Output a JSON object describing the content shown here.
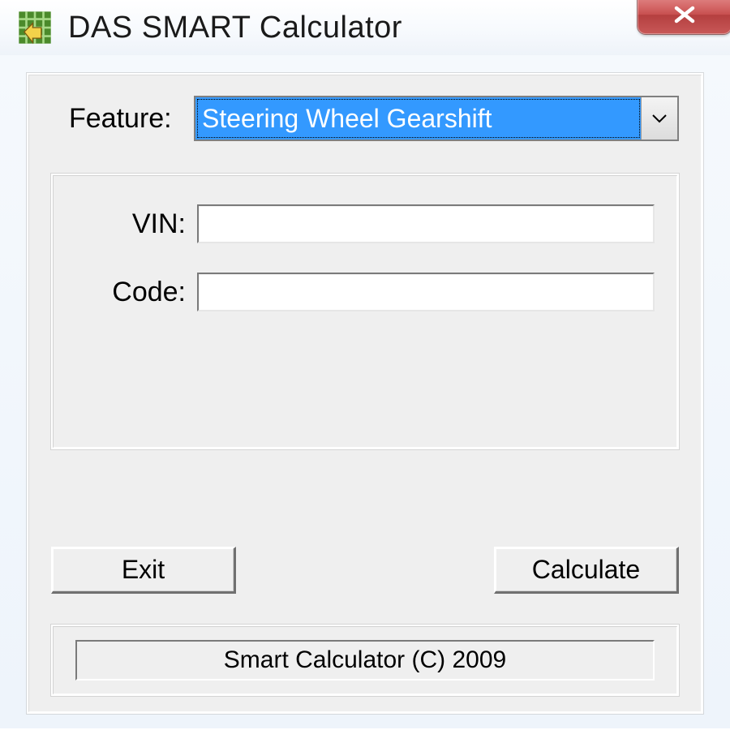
{
  "window": {
    "title": "DAS SMART Calculator"
  },
  "feature": {
    "label": "Feature:",
    "selected": "Steering Wheel Gearshift"
  },
  "inputs": {
    "vin_label": "VIN:",
    "vin_value": "",
    "code_label": "Code:",
    "code_value": ""
  },
  "buttons": {
    "exit": "Exit",
    "calculate": "Calculate"
  },
  "status": {
    "text": "Smart Calculator (C) 2009"
  }
}
